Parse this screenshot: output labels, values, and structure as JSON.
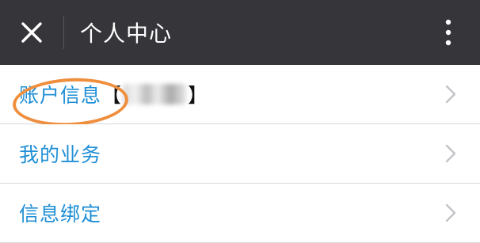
{
  "header": {
    "title": "个人中心",
    "close_icon": "close-icon",
    "more_icon": "more-vertical-icon",
    "background": "#35353a"
  },
  "menu": {
    "items": [
      {
        "label": "账户信息",
        "bracket_open": "【",
        "bracket_close": "】",
        "has_blurred_name": true
      },
      {
        "label": "我的业务"
      },
      {
        "label": "信息绑定"
      }
    ],
    "chevron_icon": "chevron-right-icon",
    "label_color": "#1f8fd6",
    "highlight_color": "#ef8e3c"
  }
}
